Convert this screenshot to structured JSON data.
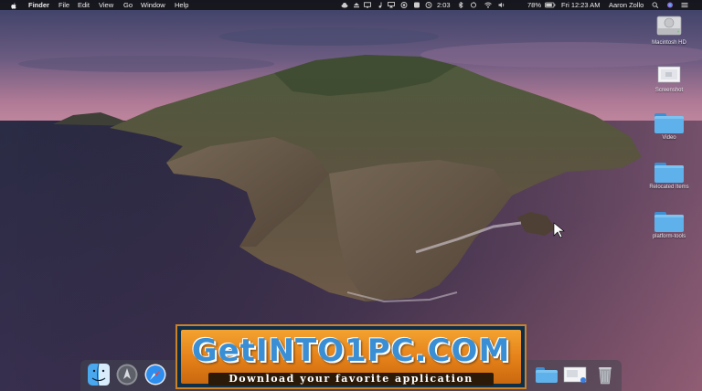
{
  "menubar": {
    "apple_icon": "apple-icon",
    "items": [
      "Finder",
      "File",
      "Edit",
      "View",
      "Go",
      "Window",
      "Help"
    ],
    "time_short": "2:03",
    "battery": "78%",
    "clock": "Fri 12:23 AM",
    "user": "Aaron Zollo"
  },
  "desktop": {
    "items": [
      {
        "label": "Macintosh HD",
        "icon": "hard-drive-icon"
      },
      {
        "label": "Screenshot",
        "icon": "screenshot-file-icon"
      },
      {
        "label": "Video",
        "icon": "folder-icon"
      },
      {
        "label": "Relocated Items",
        "icon": "folder-icon"
      },
      {
        "label": "platform-tools",
        "icon": "folder-icon"
      }
    ]
  },
  "dock": {
    "apps": [
      "finder-icon",
      "launchpad-icon",
      "safari-icon",
      "folder-icon",
      "screenshot-file-icon",
      "trash-icon"
    ]
  },
  "banner": {
    "title": "GetINTO1PC.COM",
    "subtitle": "Download your favorite application"
  }
}
